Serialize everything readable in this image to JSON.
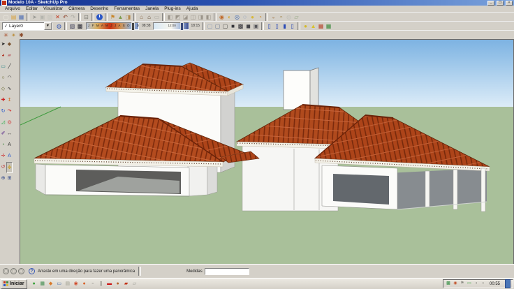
{
  "window": {
    "title": "Modelo 10A - SketchUp Pro",
    "controls": {
      "minimize": "_",
      "maximize": "❐",
      "close": "×"
    }
  },
  "menu": {
    "items": [
      {
        "name": "menu-arquivo",
        "label": "Arquivo"
      },
      {
        "name": "menu-editar",
        "label": "Editar"
      },
      {
        "name": "menu-visualizar",
        "label": "Visualizar"
      },
      {
        "name": "menu-camera",
        "label": "Câmera"
      },
      {
        "name": "menu-desenho",
        "label": "Desenho"
      },
      {
        "name": "menu-ferramentas",
        "label": "Ferramentas"
      },
      {
        "name": "menu-janela",
        "label": "Janela"
      },
      {
        "name": "menu-plugins",
        "label": "Plug-ins"
      },
      {
        "name": "menu-ajuda",
        "label": "Ajuda"
      }
    ]
  },
  "toolbar_standard": {
    "icons": [
      {
        "name": "new-file-icon",
        "glyph": "▢",
        "color": "#f5f2e8"
      },
      {
        "name": "open-folder-icon",
        "glyph": "▤",
        "color": "#d9a23c"
      },
      {
        "name": "save-icon",
        "glyph": "▦",
        "color": "#4f6fb5"
      },
      {
        "sep": true
      },
      {
        "name": "select-arrow-icon",
        "glyph": "➤",
        "color": "#9a9a94"
      },
      {
        "name": "copy-icon",
        "glyph": "▣",
        "color": "#b5b5ae"
      },
      {
        "name": "paste-icon",
        "glyph": "▨",
        "color": "#c2c2ba"
      },
      {
        "name": "delete-icon",
        "glyph": "✕",
        "color": "#c23318"
      },
      {
        "name": "undo-icon",
        "glyph": "↶",
        "color": "#8a3a20"
      },
      {
        "name": "redo-icon",
        "glyph": "↷",
        "color": "#a8a8a0"
      },
      {
        "sep": true
      },
      {
        "name": "print-icon",
        "glyph": "⊟",
        "color": "#7d7d76"
      },
      {
        "sep": true
      },
      {
        "name": "model-info-icon",
        "glyph": "ℹ",
        "color": "#ffffff",
        "bg": "#2a56c6"
      },
      {
        "sep": true
      },
      {
        "name": "add-location-icon",
        "glyph": "⚑",
        "color": "#c8862a"
      },
      {
        "name": "toggle-terrain-icon",
        "glyph": "▲",
        "color": "#7d9a4a"
      },
      {
        "name": "photo-texture-icon",
        "glyph": "◨",
        "color": "#b5884a"
      },
      {
        "sep": true
      },
      {
        "name": "previous-view-icon",
        "glyph": "⌂",
        "color": "#8a6a4a"
      },
      {
        "name": "home-view-icon",
        "glyph": "⌂",
        "color": "#5a452e"
      },
      {
        "name": "scene-icon",
        "glyph": "▭",
        "color": "#a8a8a0"
      },
      {
        "sep": true
      },
      {
        "name": "iso-view-icon",
        "glyph": "◧",
        "color": "#9a948a"
      },
      {
        "name": "top-view-icon",
        "glyph": "◩",
        "color": "#9a948a"
      },
      {
        "name": "front-view-icon",
        "glyph": "◪",
        "color": "#9a948a"
      },
      {
        "name": "right-view-icon",
        "glyph": "◫",
        "color": "#9a948a"
      },
      {
        "name": "back-view-icon",
        "glyph": "◨",
        "color": "#9a948a"
      },
      {
        "name": "left-view-icon",
        "glyph": "◧",
        "color": "#9a948a"
      },
      {
        "sep": true
      },
      {
        "name": "orbit-icon",
        "glyph": "◉",
        "color": "#c06a2a"
      },
      {
        "name": "pan-icon",
        "glyph": "◐",
        "color": "#d8a83a"
      },
      {
        "name": "zoom-icon",
        "glyph": "◎",
        "color": "#3a66b5"
      },
      {
        "name": "zoom-window-icon",
        "glyph": "◌",
        "color": "#3a66b5"
      },
      {
        "name": "zoom-extents-icon",
        "glyph": "●",
        "color": "#d8b83a"
      },
      {
        "name": "previous-camera-icon",
        "glyph": "◔",
        "color": "#c8862a"
      },
      {
        "sep": true
      },
      {
        "name": "position-camera-icon",
        "glyph": "◒",
        "color": "#b59a7a"
      },
      {
        "name": "look-around-icon",
        "glyph": "◓",
        "color": "#b5a27a"
      },
      {
        "name": "walk-icon",
        "glyph": "◍",
        "color": "#c2c2ba"
      },
      {
        "name": "section-plane-icon",
        "glyph": "▱",
        "color": "#8aa27a"
      }
    ]
  },
  "layers": {
    "checkmark": "✓",
    "selected": "Layer0",
    "dropdown_arrow": "▼",
    "left_icons": [
      {
        "name": "layer-manager-icon",
        "glyph": "◍",
        "color": "#3a5ab5"
      },
      {
        "sep": true
      },
      {
        "name": "shadow-settings-icon",
        "glyph": "▧",
        "color": "#3a3a55"
      },
      {
        "name": "shadow-toggle-icon",
        "glyph": "▩",
        "color": "#22222e"
      }
    ]
  },
  "shadows": {
    "months": "J F M A M J J A S O N D",
    "time_start": "08:38",
    "time_noon": "12:00",
    "time_end": "18:15"
  },
  "toolbar_styles": {
    "icons": [
      {
        "name": "xray-style-icon",
        "glyph": "▢",
        "color": "#8a9ab5"
      },
      {
        "name": "wireframe-style-icon",
        "glyph": "▢",
        "color": "#6a7a95"
      },
      {
        "name": "hidden-line-style-icon",
        "glyph": "▢",
        "color": "#4a4a45"
      },
      {
        "name": "shaded-style-icon",
        "glyph": "■",
        "color": "#35353a"
      },
      {
        "name": "textured-style-icon",
        "glyph": "▩",
        "color": "#2a2a30"
      },
      {
        "name": "monochrome-style-icon",
        "glyph": "◼",
        "color": "#45454a"
      },
      {
        "name": "back-edges-style-icon",
        "glyph": "▣",
        "color": "#55555a"
      },
      {
        "sep": true
      },
      {
        "name": "section-plane-toggle-icon",
        "glyph": "▯",
        "color": "#2a4ab5"
      },
      {
        "name": "section-cuts-toggle-icon",
        "glyph": "▯",
        "color": "#2a4ab5"
      },
      {
        "name": "section-fill-toggle-icon",
        "glyph": "▮",
        "color": "#2a4ab5"
      },
      {
        "name": "section-outline-toggle-icon",
        "glyph": "▯",
        "color": "#2a4ab5"
      },
      {
        "sep": true
      },
      {
        "name": "shadows-toggle-icon",
        "glyph": "●",
        "color": "#d4b92a"
      },
      {
        "name": "fog-toggle-icon",
        "glyph": "▲",
        "color": "#d8c22a"
      },
      {
        "name": "styles-palette-icon",
        "glyph": "▦",
        "color": "#b5442a"
      },
      {
        "name": "colors-palette-icon",
        "glyph": "▦",
        "color": "#3a8a3a"
      }
    ]
  },
  "toolbar_sandbox": {
    "icons": [
      {
        "name": "sandbox-from-contours-icon",
        "glyph": "✳",
        "color": "#a5431c"
      },
      {
        "name": "sandbox-from-scratch-icon",
        "glyph": "✴",
        "color": "#b9882f"
      },
      {
        "name": "smoove-icon",
        "glyph": "✱",
        "color": "#8a4a2a"
      }
    ]
  },
  "left_toolbar": {
    "tools": [
      {
        "name": "select-tool-icon",
        "glyph": "➤",
        "color": "#222222"
      },
      {
        "name": "make-component-tool-icon",
        "glyph": "◆",
        "color": "#7a5230"
      },
      {
        "name": "paint-bucket-tool-icon",
        "glyph": "◕",
        "color": "#b03020"
      },
      {
        "name": "eraser-tool-icon",
        "glyph": "▰",
        "color": "#c08080"
      },
      {
        "name": "rectangle-tool-icon",
        "glyph": "▭",
        "color": "#208080"
      },
      {
        "name": "line-tool-icon",
        "glyph": "╱",
        "color": "#333333"
      },
      {
        "name": "circle-tool-icon",
        "glyph": "○",
        "color": "#606020"
      },
      {
        "name": "arc-tool-icon",
        "glyph": "◠",
        "color": "#333333"
      },
      {
        "name": "polygon-tool-icon",
        "glyph": "◇",
        "color": "#606020"
      },
      {
        "name": "freehand-tool-icon",
        "glyph": "∿",
        "color": "#333333"
      },
      {
        "name": "move-tool-icon",
        "glyph": "✚",
        "color": "#cc2222"
      },
      {
        "name": "push-pull-tool-icon",
        "glyph": "↥",
        "color": "#cc6622"
      },
      {
        "name": "rotate-tool-icon",
        "glyph": "↻",
        "color": "#2255cc"
      },
      {
        "name": "follow-me-tool-icon",
        "glyph": "↷",
        "color": "#cc2222"
      },
      {
        "name": "scale-tool-icon",
        "glyph": "◿",
        "color": "#22aa44"
      },
      {
        "name": "offset-tool-icon",
        "glyph": "◎",
        "color": "#cc2222"
      },
      {
        "name": "tape-measure-tool-icon",
        "glyph": "✐",
        "color": "#552288"
      },
      {
        "name": "dimension-tool-icon",
        "glyph": "↔",
        "color": "#333333"
      },
      {
        "name": "protractor-tool-icon",
        "glyph": "◔",
        "color": "#227722"
      },
      {
        "name": "text-tool-icon",
        "glyph": "A",
        "color": "#333333"
      },
      {
        "name": "axes-tool-icon",
        "glyph": "✛",
        "color": "#cc3333"
      },
      {
        "name": "3d-text-tool-icon",
        "glyph": "A",
        "color": "#2255cc"
      },
      {
        "name": "orbit-tool-icon",
        "glyph": "↺",
        "color": "#bb3333"
      },
      {
        "name": "pan-tool-icon",
        "glyph": "✥",
        "color": "#caa02a",
        "pressed": true
      },
      {
        "name": "zoom-tool-icon",
        "glyph": "⊕",
        "color": "#334a8a"
      },
      {
        "name": "zoom-extents-tool-icon",
        "glyph": "⊞",
        "color": "#334a8a"
      }
    ]
  },
  "statusbar": {
    "corner_icons": [
      {
        "name": "geolocation-icon",
        "glyph": "◯",
        "color": "#7a7a74"
      },
      {
        "name": "credits-icon",
        "glyph": "◯",
        "color": "#7a7a74"
      },
      {
        "name": "claim-credit-icon",
        "glyph": "◯",
        "color": "#7a7a74"
      }
    ],
    "help_glyph": "?",
    "hint": "Arraste em uma direção para fazer uma panorâmica",
    "measure_label": "Medidas",
    "measure_value": ""
  },
  "taskbar": {
    "start_label": "Iniciar",
    "flag_colors": [
      "#c23318",
      "#3a8a3a",
      "#2a56c6",
      "#d8b83a"
    ],
    "quick_launch": [
      {
        "name": "media-player-icon",
        "glyph": "●",
        "color": "#3aa23a"
      },
      {
        "name": "spreadsheet-icon",
        "glyph": "▦",
        "color": "#3a8a4a"
      },
      {
        "name": "utility-icon",
        "glyph": "◆",
        "color": "#d87a2a"
      },
      {
        "name": "my-computer-icon",
        "glyph": "▭",
        "color": "#3a66aa"
      },
      {
        "name": "explorer-folder-icon",
        "glyph": "▤",
        "color": "#9a9a8a"
      },
      {
        "name": "chrome-icon",
        "glyph": "◉",
        "color": "#d04a2a"
      },
      {
        "name": "office-icon",
        "glyph": "●",
        "color": "#d8622a"
      },
      {
        "name": "small-app-icon",
        "glyph": "▫",
        "color": "#8a8a82"
      },
      {
        "name": "notepad-icon",
        "glyph": "▯",
        "color": "#55554a"
      },
      {
        "name": "youtube-icon",
        "glyph": "▬",
        "color": "#cc1111"
      },
      {
        "name": "firefox-icon",
        "glyph": "●",
        "color": "#b5622a"
      },
      {
        "name": "checklist-app-icon",
        "glyph": "▰",
        "color": "#c23318"
      },
      {
        "name": "show-desktop-icon",
        "glyph": "▱",
        "color": "#9a9a92"
      }
    ],
    "tray_icons": [
      {
        "name": "gpu-tray-icon",
        "glyph": "▩",
        "color": "#2a8a3a"
      },
      {
        "name": "chrome-tray-icon",
        "glyph": "◉",
        "color": "#c2522a"
      },
      {
        "name": "flag-tray-icon",
        "glyph": "⚑",
        "color": "#8a8a82"
      },
      {
        "name": "display-tray-icon",
        "glyph": "▭",
        "color": "#3aa23a"
      },
      {
        "name": "safely-remove-icon",
        "glyph": "◖",
        "color": "#8a8a82"
      },
      {
        "name": "volume-icon",
        "glyph": "◗",
        "color": "#8a8a82"
      }
    ],
    "clock": "00:55"
  },
  "scene": {
    "colors": {
      "sky_top": "#7db3e2",
      "sky_horizon": "#dcecf8",
      "ground": "#a9c09a",
      "roof_tile": "#b34b1e",
      "roof_tile_dark": "#7d2b0d",
      "roof_ridge": "#6b2208",
      "fascia": "#f3f1e8",
      "wall": "#fbfbf9",
      "wall_shade": "#d2d2d0",
      "interior_shadow": "#5d5d5b",
      "porch_shadow": "#878c90",
      "axis_green": "#3f9b3f"
    }
  }
}
